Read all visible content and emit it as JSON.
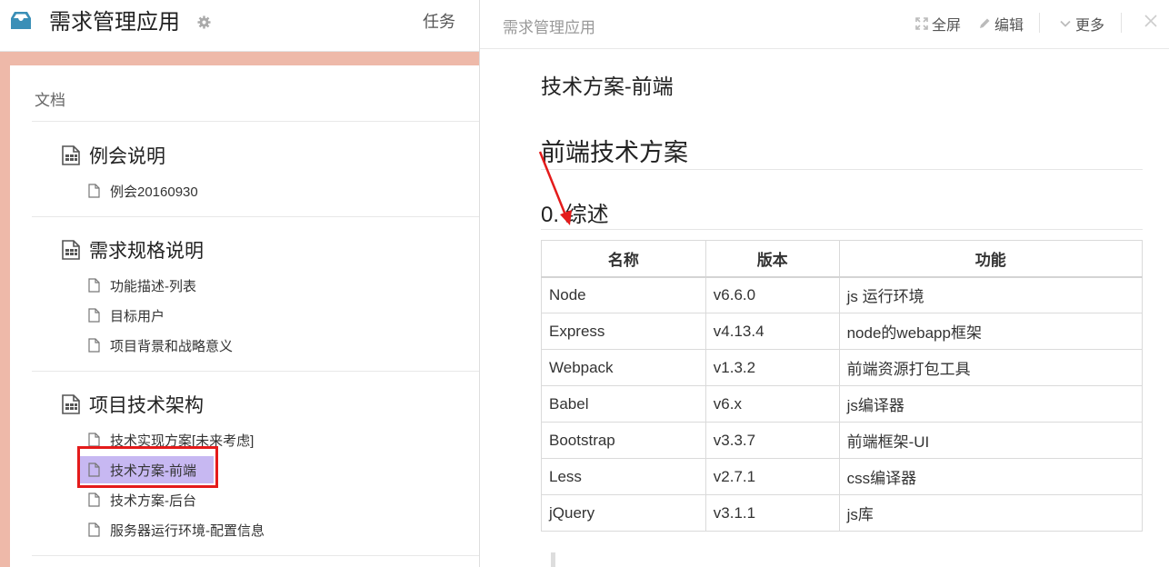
{
  "app": {
    "title": "需求管理应用",
    "nav_task": "任务"
  },
  "panel": {
    "title": "文档"
  },
  "categories": [
    {
      "label": "例会说明",
      "docs": [
        "例会20160930"
      ]
    },
    {
      "label": "需求规格说明",
      "docs": [
        "功能描述-列表",
        "目标用户",
        "项目背景和战略意义"
      ]
    },
    {
      "label": "项目技术架构",
      "docs": [
        "技术实现方案[未来考虑]",
        "技术方案-前端",
        "技术方案-后台",
        "服务器运行环境-配置信息"
      ]
    }
  ],
  "active_doc": "技术方案-前端",
  "reader": {
    "crumb": "需求管理应用",
    "toolbar": {
      "fullscreen": "全屏",
      "edit": "编辑",
      "more": "更多"
    },
    "doc_title": "技术方案-前端",
    "h1": "前端技术方案",
    "h2": "0. 综述"
  },
  "table": {
    "headers": [
      "名称",
      "版本",
      "功能"
    ],
    "rows": [
      [
        "Node",
        "v6.6.0",
        "js 运行环境"
      ],
      [
        "Express",
        "v4.13.4",
        "node的webapp框架"
      ],
      [
        "Webpack",
        "v1.3.2",
        "前端资源打包工具"
      ],
      [
        "Babel",
        "v6.x",
        "js编译器"
      ],
      [
        "Bootstrap",
        "v3.3.7",
        "前端框架-UI"
      ],
      [
        "Less",
        "v2.7.1",
        "css编译器"
      ],
      [
        "jQuery",
        "v3.1.1",
        "js库"
      ]
    ]
  },
  "colors": {
    "accent": "#3a8fb7",
    "highlight_box": "#e41b1b",
    "active_bg": "#c7b8f2",
    "backdrop": "#eeb9a9"
  },
  "icons": [
    "inbox-logo-icon",
    "gear-icon",
    "document-stack-icon",
    "file-icon",
    "expand-icon",
    "pencil-icon",
    "chevron-down-icon",
    "close-icon"
  ]
}
